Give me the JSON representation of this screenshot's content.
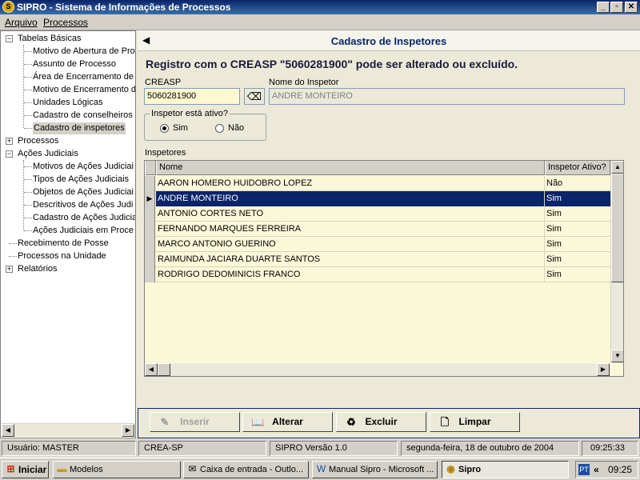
{
  "window": {
    "title": "SIPRO - Sistema de Informações de Processos",
    "min_label": "_",
    "max_label": "▫",
    "close_label": "✕"
  },
  "menu": [
    "Arquivo",
    "Processos"
  ],
  "tree": {
    "tabelas_basicas": {
      "label": "Tabelas Básicas",
      "children": [
        "Motivo de Abertura de Pro",
        "Assunto de Processo",
        "Área de Encerramento de",
        "Motivo de Encerramento d",
        "Unidades Lógicas",
        "Cadastro de conselheiros",
        "Cadastro de inspetores"
      ]
    },
    "processos": {
      "label": "Processos"
    },
    "acoes_judiciais": {
      "label": "Ações Judiciais",
      "children": [
        "Motivos de Ações Judiciai",
        "Tipos de Ações Judiciais",
        "Objetos de Ações Judiciai",
        "Descritivos de Ações Judi",
        "Cadastro de Ações Judicia",
        "Ações Judiciais em Proce"
      ]
    },
    "recebimento": {
      "label": "Recebimento de Posse"
    },
    "processos_unidade": {
      "label": "Processos na Unidade"
    },
    "relatorios": {
      "label": "Relatórios"
    }
  },
  "main": {
    "header_title": "Cadastro de Inspetores",
    "message": "Registro com o CREASP \"5060281900\" pode ser alterado ou excluído.",
    "creasp_label": "CREASP",
    "creasp_value": "5060281900",
    "name_label": "Nome do Inspetor",
    "name_value": "ANDRE MONTEIRO",
    "active_group_label": "Inspetor está ativo?",
    "radio_yes": "Sim",
    "radio_no": "Não",
    "radio_selected": "Sim",
    "grid_label": "Inspetores",
    "grid_columns": [
      "Nome",
      "Inspetor Ativo?"
    ],
    "grid_rows": [
      {
        "nome": "AARON HOMERO HUIDOBRO LOPEZ",
        "ativo": "Não"
      },
      {
        "nome": "ANDRE MONTEIRO",
        "ativo": "Sim"
      },
      {
        "nome": "ANTONIO CORTES NETO",
        "ativo": "Sim"
      },
      {
        "nome": "FERNANDO MARQUES FERREIRA",
        "ativo": "Sim"
      },
      {
        "nome": "MARCO ANTONIO GUERINO",
        "ativo": "Sim"
      },
      {
        "nome": "RAIMUNDA JACIARA DUARTE SANTOS",
        "ativo": "Sim"
      },
      {
        "nome": "RODRIGO DEDOMINICIS FRANCO",
        "ativo": "Sim"
      }
    ],
    "selected_row": 1,
    "buttons": {
      "inserir": "Inserir",
      "alterar": "Alterar",
      "excluir": "Excluir",
      "limpar": "Limpar"
    }
  },
  "status": {
    "user": "Usuário:  MASTER",
    "org": "CREA-SP",
    "version": "SIPRO Versão 1.0",
    "date": "segunda-feira, 18  de  outubro  de  2004",
    "time": "09:25:33"
  },
  "taskbar": {
    "start": "Iniciar",
    "tasks": [
      "Modelos",
      "Caixa de entrada - Outlo...",
      "Manual Sipro - Microsoft ...",
      "Sipro"
    ],
    "lang": "PT",
    "tray_arrows": "«",
    "clock": "09:25"
  },
  "colors": {
    "title_bar": "#0a246a",
    "selection": "#0a246a",
    "grid_background": "#fbf8d9",
    "input_highlight": "#fff8d0"
  },
  "icons": {
    "app": "sipro-logo-icon",
    "back": "left-arrow-icon",
    "lookup": "eraser-icon",
    "inserir": "edit-icon",
    "alterar": "book-icon",
    "excluir": "recycle-bin-icon",
    "limpar": "blank-page-icon"
  }
}
